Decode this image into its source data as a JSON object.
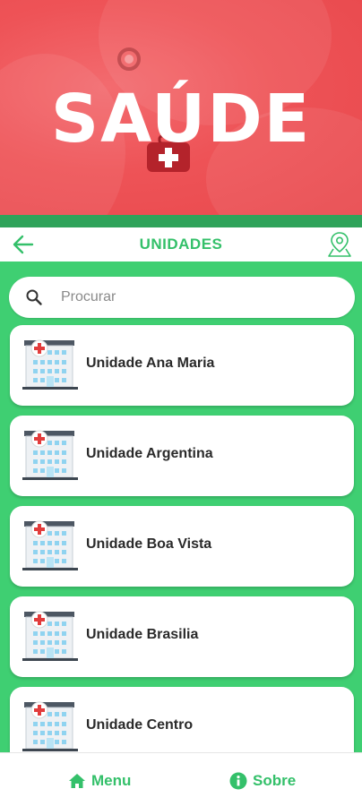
{
  "banner": {
    "title": "SAÚDE"
  },
  "header": {
    "title": "UNIDADES",
    "back_icon": "arrow-left-icon",
    "map_icon": "map-pin-icon"
  },
  "search": {
    "placeholder": "Procurar",
    "value": ""
  },
  "units": [
    {
      "name": "Unidade Ana Maria"
    },
    {
      "name": "Unidade Argentina"
    },
    {
      "name": "Unidade Boa Vista"
    },
    {
      "name": "Unidade Brasilia"
    },
    {
      "name": "Unidade Centro"
    }
  ],
  "bottom_nav": {
    "menu_label": "Menu",
    "sobre_label": "Sobre"
  },
  "colors": {
    "primary_green": "#34c06a",
    "content_bg": "#3fcf72",
    "banner_red": "#ee5357",
    "strip_green": "#2fa35a"
  }
}
